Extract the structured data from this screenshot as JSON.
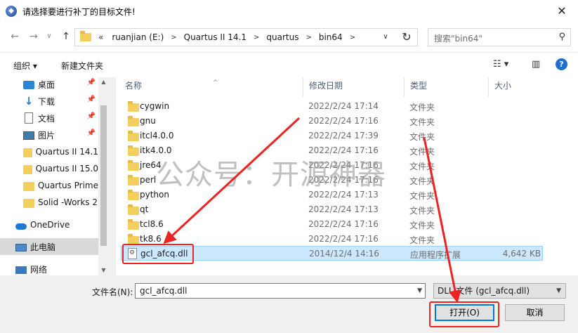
{
  "window": {
    "title": "请选择要进行补丁的目标文件!",
    "close_glyph": "✕"
  },
  "nav": {
    "back": "←",
    "forward": "→",
    "recent": "∨",
    "up": "↑",
    "overflow": "«",
    "breadcrumb": [
      "ruanjian (E:)",
      "Quartus II 14.1",
      "quartus",
      "bin64"
    ],
    "refresh": "↻",
    "search_placeholder": "搜索\"bin64\""
  },
  "toolbar": {
    "organize": "组织 ▾",
    "new_folder": "新建文件夹",
    "view_icon": "☷ ▾",
    "pane_icon": "▥",
    "help": "?"
  },
  "sidebar": {
    "items": [
      {
        "label": "桌面",
        "icon": "desktop-icon",
        "pinned": true
      },
      {
        "label": "下载",
        "icon": "download-icon",
        "pinned": true
      },
      {
        "label": "文档",
        "icon": "document-icon",
        "pinned": true
      },
      {
        "label": "图片",
        "icon": "pictures-icon",
        "pinned": true
      },
      {
        "label": "Quartus II 14.1",
        "icon": "folder-icon",
        "pinned": false
      },
      {
        "label": "Quartus II 15.0",
        "icon": "folder-icon",
        "pinned": false
      },
      {
        "label": "Quartus Prime",
        "icon": "folder-icon",
        "pinned": false
      },
      {
        "label": "Solid -Works 2",
        "icon": "folder-icon",
        "pinned": false
      },
      {
        "label": "OneDrive",
        "icon": "onedrive-icon",
        "pinned": false
      },
      {
        "label": "此电脑",
        "icon": "this-pc-icon",
        "pinned": false,
        "selected": true
      },
      {
        "label": "网络",
        "icon": "network-icon",
        "pinned": false
      }
    ],
    "pin_glyph": "📌"
  },
  "columns": {
    "name": "名称",
    "date": "修改日期",
    "type": "类型",
    "size": "大小"
  },
  "files": [
    {
      "name": "cygwin",
      "date": "2022/2/24 17:14",
      "type": "文件夹",
      "size": "",
      "kind": "folder"
    },
    {
      "name": "gnu",
      "date": "2022/2/24 17:16",
      "type": "文件夹",
      "size": "",
      "kind": "folder"
    },
    {
      "name": "itcl4.0.0",
      "date": "2022/2/24 17:39",
      "type": "文件夹",
      "size": "",
      "kind": "folder"
    },
    {
      "name": "itk4.0.0",
      "date": "2022/2/24 17:16",
      "type": "文件夹",
      "size": "",
      "kind": "folder"
    },
    {
      "name": "jre64",
      "date": "2022/2/24 17:16",
      "type": "文件夹",
      "size": "",
      "kind": "folder"
    },
    {
      "name": "perl",
      "date": "2022/2/24 17:16",
      "type": "文件夹",
      "size": "",
      "kind": "folder"
    },
    {
      "name": "python",
      "date": "2022/2/24 17:13",
      "type": "文件夹",
      "size": "",
      "kind": "folder"
    },
    {
      "name": "qt",
      "date": "2022/2/24 17:13",
      "type": "文件夹",
      "size": "",
      "kind": "folder"
    },
    {
      "name": "tcl8.6",
      "date": "2022/2/24 17:16",
      "type": "文件夹",
      "size": "",
      "kind": "folder"
    },
    {
      "name": "tk8.6",
      "date": "2022/2/24 17:16",
      "type": "文件夹",
      "size": "",
      "kind": "folder"
    },
    {
      "name": "gcl_afcq.dll",
      "date": "2014/12/4 14:16",
      "type": "应用程序扩展",
      "size": "4,642 KB",
      "kind": "dll",
      "selected": true
    }
  ],
  "watermark": "公众号：开源神器",
  "bottom": {
    "filename_label": "文件名(N):",
    "filename_value": "gcl_afcq.dll",
    "filetype_value": "DLL 文件 (gcl_afcq.dll)",
    "open_label": "打开(O)",
    "cancel_label": "取消"
  },
  "colors": {
    "highlight_red": "#ee2222",
    "selection_blue": "#cce8ff",
    "primary_border": "#0078d7"
  }
}
